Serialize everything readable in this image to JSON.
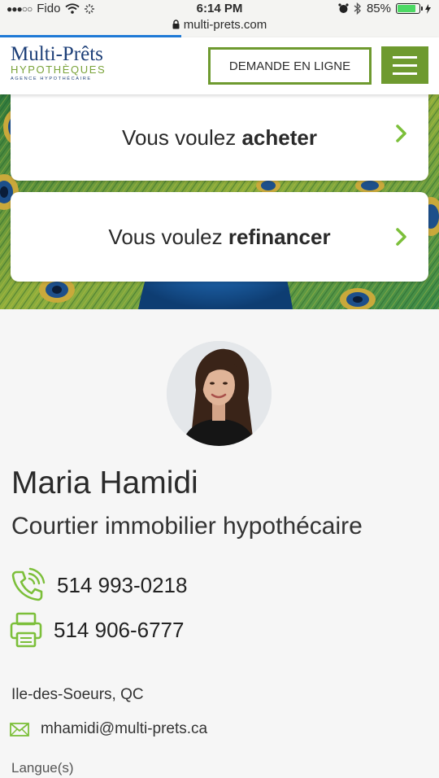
{
  "status_bar": {
    "carrier": "Fido",
    "time": "6:14 PM",
    "battery": "85%",
    "battery_level": 0.85,
    "url": "multi-prets.com"
  },
  "header": {
    "logo_main": "Multi-Prêts",
    "logo_sub": "HYPOTHÈQUES",
    "logo_agency": "AGENCE HYPOTHÉCAIRE",
    "cta_label": "DEMANDE EN LIGNE",
    "menu_icon": "hamburger-menu-icon"
  },
  "hero": {
    "card1": {
      "prefix": "Vous voulez ",
      "bold": "acheter"
    },
    "card2": {
      "prefix": "Vous voulez ",
      "bold": "refinancer"
    },
    "chevron_icon": "chevron-right-icon"
  },
  "profile": {
    "name": "Maria Hamidi",
    "title": "Courtier immobilier hypothécaire",
    "phone": "514 993-0218",
    "fax": "514 906-6777",
    "city": "Ile-des-Soeurs, QC",
    "email": "mhamidi@multi-prets.ca",
    "languages_label": "Langue(s)"
  },
  "colors": {
    "brand_green": "#6e9a2f",
    "brand_blue": "#1d3f78",
    "icon_green": "#7cbf3a"
  }
}
